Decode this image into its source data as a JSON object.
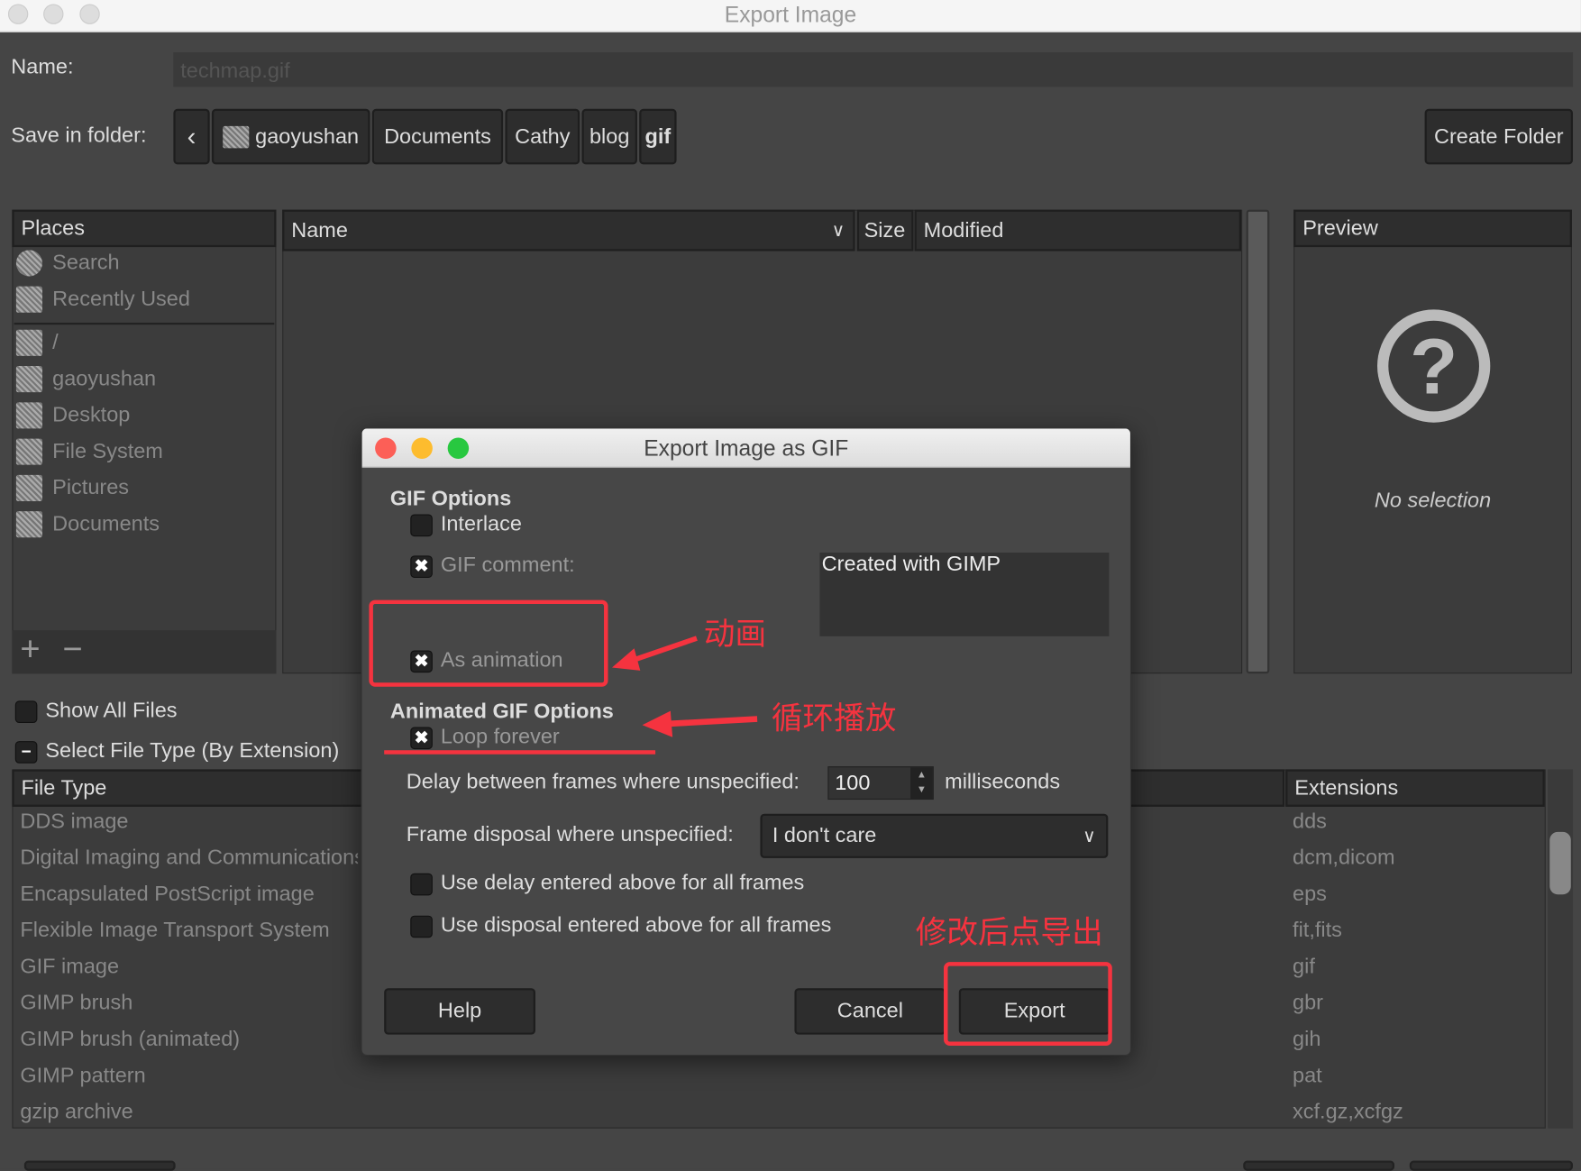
{
  "window": {
    "title": "Export Image"
  },
  "name_field": {
    "label": "Name:",
    "value": "techmap.gif"
  },
  "save_in": {
    "label": "Save in folder:",
    "path": [
      "gaoyushan",
      "Documents",
      "Cathy",
      "blog",
      "gif"
    ],
    "create_folder": "Create Folder"
  },
  "places": {
    "header": "Places",
    "items": [
      {
        "label": "Search",
        "icon": "search-icon"
      },
      {
        "label": "Recently Used",
        "icon": "recent-icon"
      },
      {
        "label": "/",
        "icon": "drive-icon"
      },
      {
        "label": "gaoyushan",
        "icon": "folder-icon"
      },
      {
        "label": "Desktop",
        "icon": "folder-icon"
      },
      {
        "label": "File System",
        "icon": "drive-icon"
      },
      {
        "label": "Pictures",
        "icon": "folder-icon"
      },
      {
        "label": "Documents",
        "icon": "folder-icon"
      }
    ],
    "add": "+",
    "remove": "−"
  },
  "files": {
    "columns": [
      "Name",
      "Size",
      "Modified"
    ]
  },
  "preview": {
    "header": "Preview",
    "empty": "No selection"
  },
  "show_all_files": "Show All Files",
  "select_file_type": "Select File Type (By Extension)",
  "file_types": {
    "columns": [
      "File Type",
      "Extensions"
    ],
    "rows": [
      [
        "DDS image",
        "dds"
      ],
      [
        "Digital Imaging and Communications",
        "dcm,dicom"
      ],
      [
        "Encapsulated PostScript image",
        "eps"
      ],
      [
        "Flexible Image Transport System",
        "fit,fits"
      ],
      [
        "GIF image",
        "gif"
      ],
      [
        "GIMP brush",
        "gbr"
      ],
      [
        "GIMP brush (animated)",
        "gih"
      ],
      [
        "GIMP pattern",
        "pat"
      ],
      [
        "gzip archive",
        "xcf.gz,xcfgz"
      ]
    ]
  },
  "dialog": {
    "title": "Export Image as GIF",
    "gif_options": "GIF Options",
    "interlace": {
      "label": "Interlace",
      "checked": false
    },
    "gif_comment": {
      "label": "GIF comment:",
      "checked": true,
      "value": "Created with GIMP"
    },
    "as_animation": {
      "label": "As animation",
      "checked": true
    },
    "animated_options": "Animated GIF Options",
    "loop_forever": {
      "label": "Loop forever",
      "checked": true
    },
    "delay": {
      "label": "Delay between frames where unspecified:",
      "value": "100",
      "unit": "milliseconds"
    },
    "disposal": {
      "label": "Frame disposal where unspecified:",
      "value": "I don't care"
    },
    "use_delay": {
      "label": "Use delay entered above for all frames",
      "checked": false
    },
    "use_disposal": {
      "label": "Use disposal entered above for all frames",
      "checked": false
    },
    "help": "Help",
    "cancel": "Cancel",
    "export": "Export"
  },
  "annotations": {
    "animation": "动画",
    "loop": "循环播放",
    "export": "修改后点导出",
    "color": "#f5333f"
  }
}
